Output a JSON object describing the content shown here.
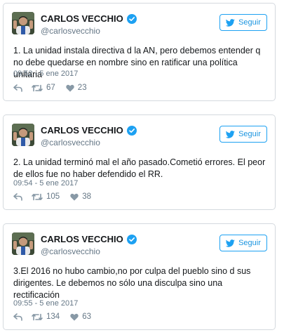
{
  "colors": {
    "accent": "#1da1f2",
    "text": "#14171a",
    "muted": "#657786",
    "border": "#d4d9de"
  },
  "icons": {
    "verified": "verified-badge-icon",
    "bird": "twitter-bird-icon",
    "reply": "reply-arrow-icon",
    "retweet": "retweet-icon",
    "like": "heart-icon"
  },
  "tweets": [
    {
      "author_name": "CARLOS VECCHIO",
      "handle": "@carlosvecchio",
      "follow_label": "Seguir",
      "text": "1. La unidad instala directiva d la AN, pero debemos entender q no debe quedarse en nombre sino en ratificar una política unitaria",
      "time": "09:52 - 5 ene 2017",
      "retweets": "67",
      "likes": "23"
    },
    {
      "author_name": "CARLOS VECCHIO",
      "handle": "@carlosvecchio",
      "follow_label": "Seguir",
      "text": "2. La unidad terminó mal el año pasado.Cometió errores. El peor de ellos fue no haber defendido el RR.",
      "time": "09:54 - 5 ene 2017",
      "retweets": "105",
      "likes": "38"
    },
    {
      "author_name": "CARLOS VECCHIO",
      "handle": "@carlosvecchio",
      "follow_label": "Seguir",
      "text": "3.El 2016 no hubo cambio,no por culpa del pueblo sino d sus dirigentes. Le debemos no sólo una disculpa sino una rectificación",
      "time": "09:55 - 5 ene 2017",
      "retweets": "134",
      "likes": "63"
    }
  ]
}
